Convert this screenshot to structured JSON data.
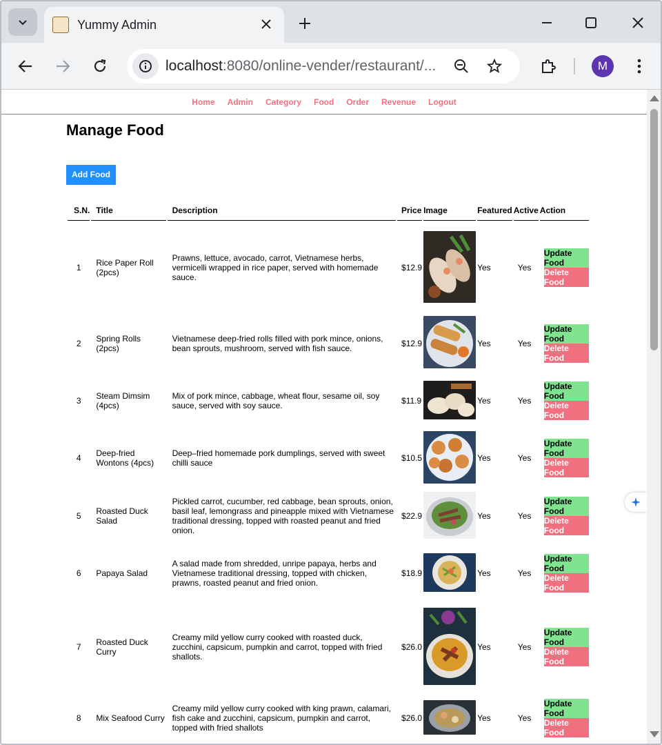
{
  "browser": {
    "tab_title": "Yummy Admin",
    "url_host": "localhost",
    "url_rest": ":8080/online-vender/restaurant/...",
    "profile_initial": "M"
  },
  "nav": {
    "items": [
      "Home",
      "Admin",
      "Category",
      "Food",
      "Order",
      "Revenue",
      "Logout"
    ]
  },
  "page": {
    "title": "Manage Food",
    "add_button": "Add Food"
  },
  "table": {
    "headers": [
      "S.N.",
      "Title",
      "Description",
      "Price",
      "Image",
      "Featured",
      "Active",
      "Action"
    ],
    "update_label": "Update Food",
    "delete_label": "Delete Food",
    "rows": [
      {
        "sn": "1",
        "title": "Rice Paper Roll (2pcs)",
        "description": "Prawns, lettuce, avocado, carrot, Vietnamese herbs, vermicelli wrapped in rice paper, served with homemade sauce.",
        "price": "$12.9",
        "featured": "Yes",
        "active": "Yes",
        "image": "rice-paper-roll-photo"
      },
      {
        "sn": "2",
        "title": "Spring Rolls (2pcs)",
        "description": "Vietnamese deep-fried rolls filled with pork mince, onions, bean sprouts, mushroom, served with fish sauce.",
        "price": "$12.9",
        "featured": "Yes",
        "active": "Yes",
        "image": "spring-rolls-photo"
      },
      {
        "sn": "3",
        "title": "Steam Dimsim (4pcs)",
        "description": "Mix of pork mince, cabbage, wheat flour, sesame oil, soy sauce, served with soy sauce.",
        "price": "$11.9",
        "featured": "Yes",
        "active": "Yes",
        "image": "dimsim-photo"
      },
      {
        "sn": "4",
        "title": "Deep-fried Wontons (4pcs)",
        "description": "Deep–fried homemade pork dumplings, served with sweet chilli sauce",
        "price": "$10.5",
        "featured": "Yes",
        "active": "Yes",
        "image": "wontons-photo"
      },
      {
        "sn": "5",
        "title": "Roasted Duck Salad",
        "description": "Pickled carrot, cucumber, red cabbage, bean sprouts, onion, basil leaf, lemongrass and pineapple mixed with Vietnamese traditional dressing, topped with roasted peanut and fried onion.",
        "price": "$22.9",
        "featured": "Yes",
        "active": "Yes",
        "image": "duck-salad-photo"
      },
      {
        "sn": "6",
        "title": "Papaya Salad",
        "description": "A salad made from shredded, unripe papaya, herbs and Vietnamese traditional dressing, topped with chicken, prawns, roasted peanut and fried onion.",
        "price": "$18.9",
        "featured": "Yes",
        "active": "Yes",
        "image": "papaya-salad-photo"
      },
      {
        "sn": "7",
        "title": "Roasted Duck Curry",
        "description": "Creamy mild yellow curry cooked with roasted duck, zucchini, capsicum, pumpkin and carrot, topped with fried shallots.",
        "price": "$26.0",
        "featured": "Yes",
        "active": "Yes",
        "image": "duck-curry-photo"
      },
      {
        "sn": "8",
        "title": "Mix Seafood Curry",
        "description": "Creamy mild yellow curry cooked with king prawn, calamari, fish cake and zucchini, capsicum, pumpkin and carrot, topped with fried shallots",
        "price": "$26.0",
        "featured": "Yes",
        "active": "Yes",
        "image": "seafood-curry-photo"
      }
    ]
  },
  "colors": {
    "nav_link": "#f0707f",
    "add_button": "#1e90ff",
    "update_badge": "#7fe38f",
    "delete_badge": "#f0707f"
  }
}
